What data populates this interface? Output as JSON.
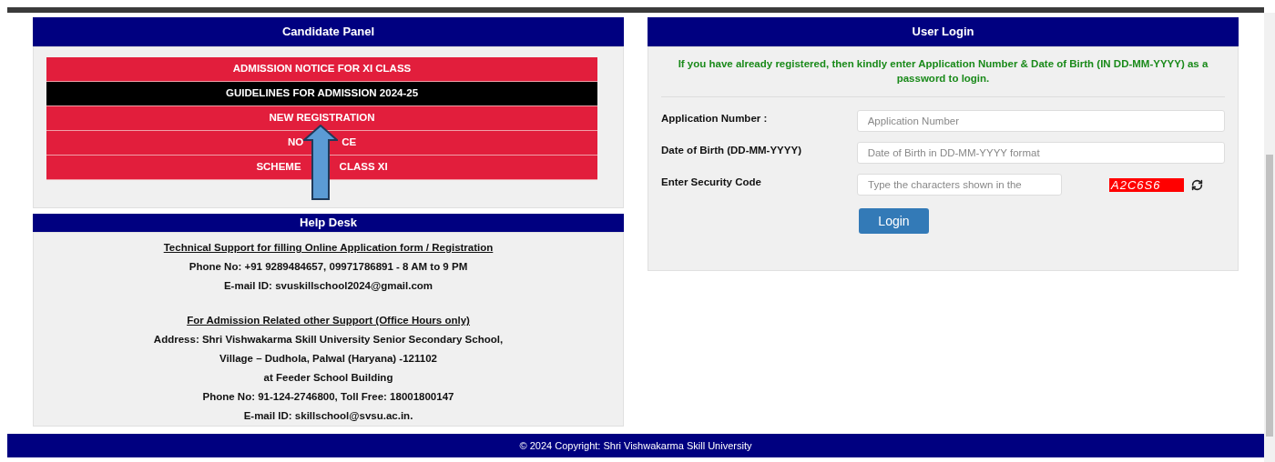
{
  "candidate_panel": {
    "title": "Candidate Panel",
    "links": [
      {
        "kind": "red",
        "segments": [
          "ADMISSION NOTICE FOR XI CLASS"
        ]
      },
      {
        "kind": "black",
        "segments": [
          "GUIDELINES FOR ADMISSION 2024-25"
        ]
      },
      {
        "kind": "red",
        "segments": [
          "NEW REGISTRATION"
        ]
      },
      {
        "kind": "red",
        "segments": [
          "NO",
          "CE"
        ]
      },
      {
        "kind": "red",
        "segments": [
          "SCHEME",
          "CLASS XI"
        ]
      }
    ]
  },
  "help_desk": {
    "title": "Help Desk",
    "lines": [
      {
        "kind": "heading",
        "text": "Technical Support for filling Online Application form / Registration"
      },
      {
        "kind": "line",
        "text": "Phone No: +91 9289484657, 09971786891 - 8 AM to 9 PM"
      },
      {
        "kind": "line",
        "text": "E-mail ID: svuskillschool2024@gmail.com"
      },
      {
        "kind": "heading",
        "text": "For Admission Related other Support (Office Hours only)"
      },
      {
        "kind": "line",
        "text": "Address: Shri Vishwakarma Skill University Senior Secondary School,"
      },
      {
        "kind": "line",
        "text": "Village – Dudhola, Palwal (Haryana) -121102"
      },
      {
        "kind": "line",
        "text": "at Feeder School Building"
      },
      {
        "kind": "line",
        "text": "Phone No: 91-124-2746800, Toll Free: 18001800147"
      },
      {
        "kind": "line",
        "text": "E-mail ID: skillschool@svsu.ac.in."
      }
    ]
  },
  "user_login": {
    "title": "User Login",
    "notice": "If you have already registered, then kindly enter Application Number & Date of Birth (IN DD-MM-YYYY) as a password to login.",
    "fields": [
      {
        "kind": "text",
        "label": "Application Number :",
        "placeholder": "Application Number"
      },
      {
        "kind": "text",
        "label": "Date of Birth (DD-MM-YYYY)",
        "placeholder": "Date of Birth in DD-MM-YYYY format"
      },
      {
        "kind": "captcha",
        "label": "Enter Security Code",
        "placeholder": "Type the characters shown in the",
        "captcha": "A2C6S6"
      }
    ],
    "button": "Login"
  },
  "footer": "© 2024 Copyright: Shri Vishwakarma Skill University"
}
